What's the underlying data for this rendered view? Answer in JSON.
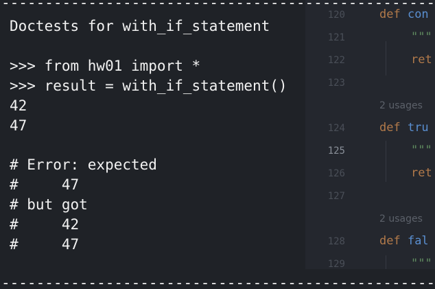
{
  "terminal": {
    "rule": "------------------------------------------------------------",
    "lines": [
      "Doctests for with_if_statement",
      "",
      ">>> from hw01 import *",
      ">>> result = with_if_statement()",
      "42",
      "47",
      "",
      "# Error: expected",
      "#     47",
      "# but got",
      "#     42",
      "#     47"
    ]
  },
  "editor": {
    "line_numbers": [
      "120",
      "121",
      "122",
      "123",
      "124",
      "125",
      "126",
      "127",
      "128",
      "129"
    ],
    "active_line": "125",
    "code": {
      "l120_kw": "def ",
      "l120_fn": "con",
      "l121_doc": "\"\"\"",
      "l122_ret": "ret",
      "usages1": "2 usages",
      "l124_kw": "def ",
      "l124_fn": "tru",
      "l125_doc": "\"\"\"",
      "l126_ret": "ret",
      "usages2": "2 usages",
      "l128_kw": "def ",
      "l128_fn": "fal",
      "l129_doc": "\"\"\""
    }
  },
  "colors": {
    "background": "#1f2227",
    "editor_background": "#24272e",
    "text": "#f2f2f2",
    "keyword": "#b27a4a",
    "function": "#5a8fd1",
    "docstring": "#5f8a5f",
    "line_number": "#4a4f58"
  }
}
